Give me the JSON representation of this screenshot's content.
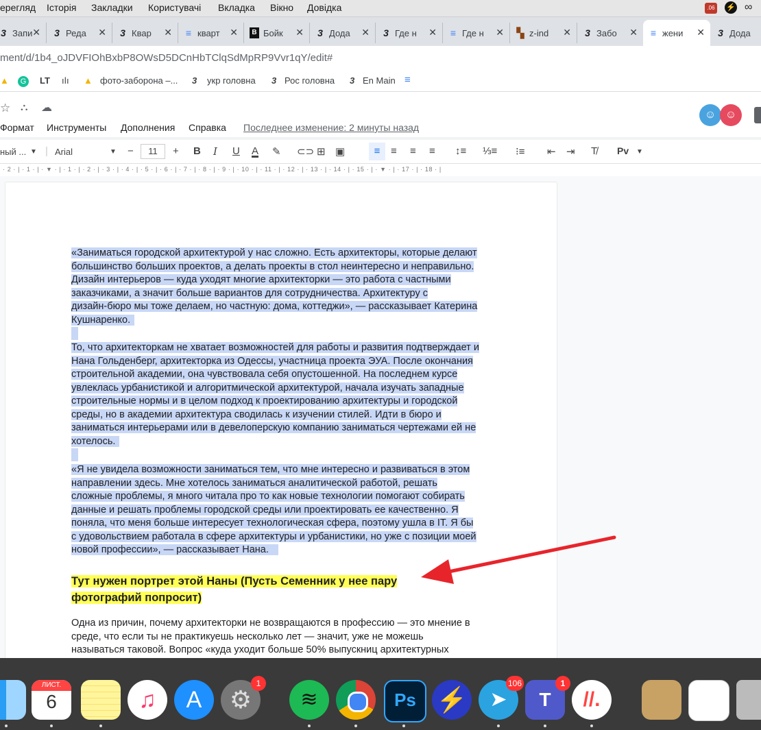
{
  "menubar": {
    "items": [
      "ерегляд",
      "Історія",
      "Закладки",
      "Користувачі",
      "Вкладка",
      "Вікно",
      "Довідка"
    ],
    "battery_badge": ".06"
  },
  "tabs": [
    {
      "icon": "3",
      "title": "Запи"
    },
    {
      "icon": "3",
      "title": "Реда"
    },
    {
      "icon": "3",
      "title": "Квар"
    },
    {
      "icon": "≡",
      "title": "кварт"
    },
    {
      "icon": "B",
      "title": "Бойк"
    },
    {
      "icon": "3",
      "title": "Дода"
    },
    {
      "icon": "3",
      "title": "Где н"
    },
    {
      "icon": "≡",
      "title": "Где н"
    },
    {
      "icon": "▚",
      "title": "z-ind"
    },
    {
      "icon": "3",
      "title": "Забо"
    },
    {
      "icon": "≡",
      "title": "жени",
      "active": true
    },
    {
      "icon": "3",
      "title": "Дода"
    }
  ],
  "address": "ment/d/1b4_oJDVFIOhBxbP8OWsD5DCnHbTClqSdMpRP9Vvr1qY/edit#",
  "bookmarks": [
    "фото-заборона –...",
    "укр головна",
    "Рос головна",
    "En Main"
  ],
  "docs_menu": [
    "Формат",
    "Инструменты",
    "Дополнения",
    "Справка"
  ],
  "last_edit": "Последнее изменение: 2 минуты назад",
  "toolbar": {
    "style": "ный ...",
    "font": "Arial",
    "size": "11",
    "spell": "Рv"
  },
  "ruler": "· 2 · | · 1 · | · ▼ · | · 1 · | · 2 · | · 3 · | · 4 · | · 5 · | · 6 · | · 7 · | · 8 · | · 9 · | · 10 · | · 11 · | · 12 · | · 13 · | · 14 · | · 15 · | · ▼ · | · 17 · | · 18 · |",
  "document": {
    "p1": [
      "«Заниматься городской архитектурой у нас сложно. Есть архитекторы, которые делают",
      "большинство больших проектов, а  делать проекты в стол неинтересно и неправильно.",
      "Дизайн интерьеров — куда уходят многие архитекторки — это работа с частными",
      "заказчиками, а значит больше вариантов для сотрудничества. Архитектуру с",
      "дизайн-бюро мы тоже делаем, но частную: дома, коттеджи», — рассказывает Катерина",
      "Кушнаренко."
    ],
    "p2": [
      "То, что архитекторкам не хватает возможностей для работы и развития подтверждает и",
      "Нана Гольденберг, архитекторка из Одессы, участница проекта ЭУА. После окончания",
      "строительной академии, она чувствовала себя опустошенной. На последнем курсе",
      "увлеклась урбанистикой и алгоритмической архитектурой, начала изучать западные",
      "строительные нормы и в целом подход к проектированию архитектуры и городской",
      "среды, но в академии архитектура сводилась к изучении стилей. Идти в бюро и",
      "заниматься интерьерами или в девелоперскую компанию заниматься чертежами ей не",
      "хотелось."
    ],
    "p3": [
      "«Я не увидела возможности заниматься тем, что мне интересно и развиваться в этом",
      "направлении здесь. Мне хотелось заниматься аналитической работой, решать",
      "сложные проблемы, я много читала про то как новые технологии помогают собирать",
      "данные и решать проблемы городской среды или проектировать ее качественно. Я",
      "поняла, что меня больше интересует технологическая сфера, поэтому ушла в IT. Я бы",
      "с удовольствием работала в сфере архитектуры и урбанистики, но уже с позиции моей",
      "новой профессии», — рассказывает Нана."
    ],
    "heading": [
      "Тут нужен портрет этой Наны (Пусть Семенник у нее пару",
      "фотографий попросит)"
    ],
    "p4": [
      "Одна из причин, почему архитекторки не возвращаются в профессию — это мнение в",
      "среде, что если ты не практикуешь несколько лет — значит, уже не можешь",
      "называться таковой. Вопрос «куда уходит больше 50% выпускниц архитектурных"
    ]
  },
  "dock": {
    "calendar_month": "ЛИСТ.",
    "calendar_day": "6",
    "badges": {
      "settings": "1",
      "telegram": "106",
      "teams": "1"
    }
  },
  "colors": {
    "selection": "#c8d7f6",
    "highlight": "#ffff54",
    "arrow": "#e8242b",
    "docs_blue": "#4285f4"
  }
}
